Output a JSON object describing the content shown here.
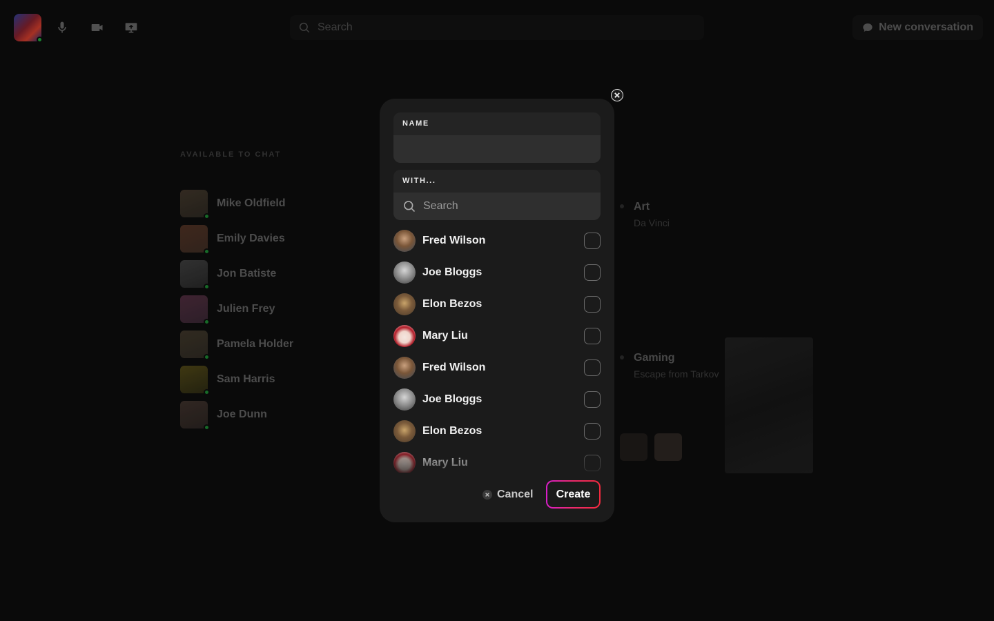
{
  "topbar": {
    "search_placeholder": "Search",
    "new_conversation_label": "New conversation",
    "icons": [
      "microphone-icon",
      "video-camera-icon",
      "screen-share-icon",
      "search-icon",
      "chat-bubble-icon"
    ]
  },
  "available": {
    "title": "AVAILABLE TO CHAT",
    "contacts": [
      {
        "name": "Mike Oldfield"
      },
      {
        "name": "Emily Davies"
      },
      {
        "name": "Jon Batiste"
      },
      {
        "name": "Julien Frey"
      },
      {
        "name": "Pamela Holder"
      },
      {
        "name": "Sam Harris"
      },
      {
        "name": "Joe Dunn"
      }
    ]
  },
  "cards": {
    "art": {
      "title": "Art",
      "subtitle": "Da Vinci"
    },
    "gaming": {
      "title": "Gaming",
      "subtitle": "Escape from Tarkov"
    }
  },
  "modal": {
    "name_label": "NAME",
    "name_value": "",
    "with_label": "WITH...",
    "with_search_placeholder": "Search",
    "people": [
      {
        "name": "Fred Wilson",
        "checked": false
      },
      {
        "name": "Joe Bloggs",
        "checked": false
      },
      {
        "name": "Elon Bezos",
        "checked": false
      },
      {
        "name": "Mary Liu",
        "checked": false
      },
      {
        "name": "Fred Wilson",
        "checked": false
      },
      {
        "name": "Joe Bloggs",
        "checked": false
      },
      {
        "name": "Elon Bezos",
        "checked": false
      },
      {
        "name": "Mary Liu",
        "checked": false
      }
    ],
    "cancel_label": "Cancel",
    "create_label": "Create"
  },
  "colors": {
    "accent_gradient_start": "#d81ec9",
    "accent_gradient_end": "#f22a3d",
    "online": "#1f9d3a",
    "modal_bg": "#1b1b1b"
  }
}
